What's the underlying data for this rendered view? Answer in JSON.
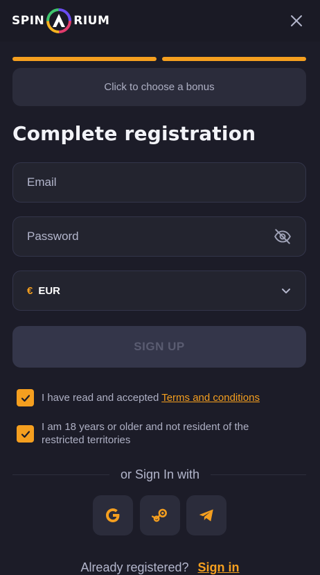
{
  "header": {
    "logo_left": "SPIN",
    "logo_right": "RIUM",
    "close_icon": "close-icon"
  },
  "progress": {
    "steps_total": 2,
    "steps_filled": 2,
    "color": "#f59f1f"
  },
  "bonus": {
    "label": "Click to choose a bonus"
  },
  "form": {
    "title": "Complete registration",
    "email_placeholder": "Email",
    "password_placeholder": "Password",
    "password_toggle_icon": "eye-off-icon",
    "currency_symbol": "€",
    "currency_value": "EUR",
    "currency_icon": "chevron-down-icon",
    "signup_label": "SIGN UP"
  },
  "checks": {
    "terms_text": "I have read and accepted",
    "terms_link": "Terms and conditions",
    "terms_checked": true,
    "age_text": "I am 18 years or older and not resident of the restricted territories",
    "age_checked": true
  },
  "social": {
    "or_text": "or Sign In with",
    "providers": [
      "google-icon",
      "steam-icon",
      "telegram-icon"
    ]
  },
  "footer": {
    "already_text": "Already registered?",
    "signin_link": "Sign in"
  },
  "colors": {
    "accent": "#f59f1f",
    "background": "#1c1c28",
    "surface": "#2b2c3b"
  }
}
